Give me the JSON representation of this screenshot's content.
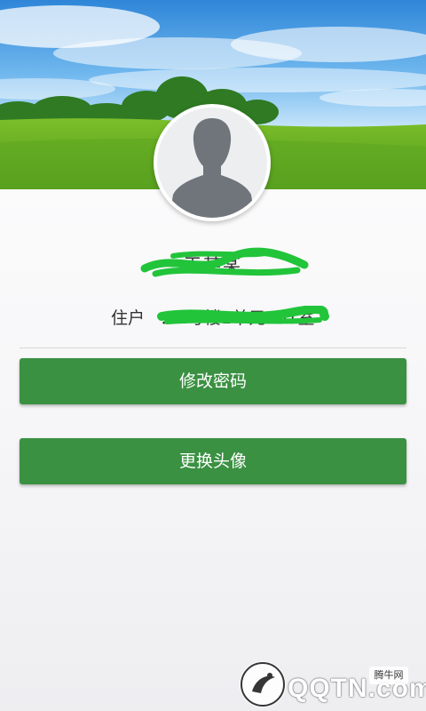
{
  "profile": {
    "name": "王某某",
    "resident_label": "住户",
    "resident_value": "：1号楼1单元201室"
  },
  "actions": {
    "change_password": "修改密码",
    "change_avatar": "更换头像"
  },
  "watermark": {
    "brand": "QQTN.com",
    "tag": "腾牛网"
  },
  "icons": {
    "avatar": "default-avatar-icon",
    "watermark_logo": "qqtn-logo-icon"
  },
  "colors": {
    "primary_button": "#3b9142",
    "redaction": "#22c43a"
  }
}
